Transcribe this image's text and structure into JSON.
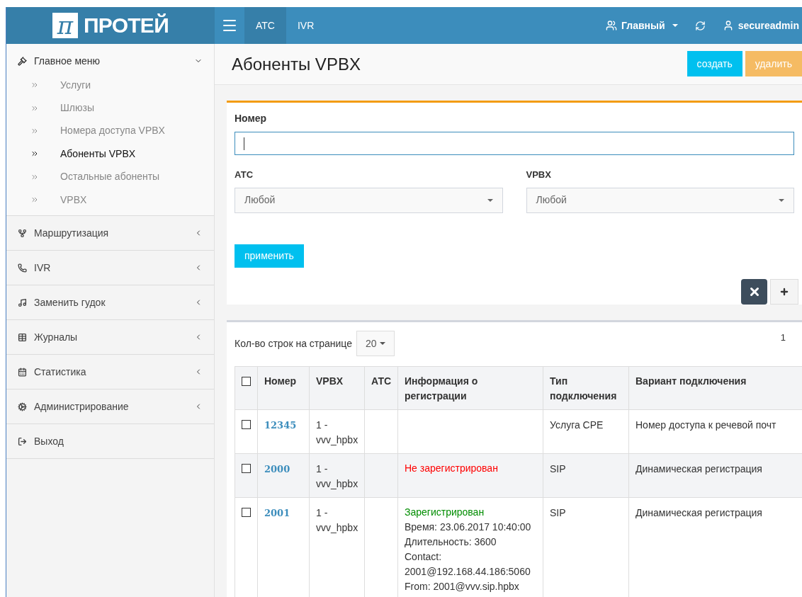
{
  "logo": {
    "mark": "π",
    "name": "ПРОТЕЙ"
  },
  "top_tabs": [
    {
      "label": "АТС",
      "selected": true
    },
    {
      "label": "IVR",
      "selected": false
    }
  ],
  "top_right": {
    "group": "Главный",
    "user": "secureadmin"
  },
  "sidebar": [
    {
      "label": "Главное меню",
      "kind": "group",
      "expanded": true,
      "children": [
        {
          "label": "Услуги",
          "selected": false
        },
        {
          "label": "Шлюзы",
          "selected": false
        },
        {
          "label": "Номера доступа VPBX",
          "selected": false
        },
        {
          "label": "Абоненты VPBX",
          "selected": true
        },
        {
          "label": "Остальные абоненты",
          "selected": false
        },
        {
          "label": "VPBX",
          "selected": false
        }
      ]
    },
    {
      "label": "Маршрутизация",
      "kind": "group",
      "expanded": false
    },
    {
      "label": "IVR",
      "kind": "group",
      "expanded": false
    },
    {
      "label": "Заменить гудок",
      "kind": "group",
      "expanded": false
    },
    {
      "label": "Журналы",
      "kind": "group",
      "expanded": false
    },
    {
      "label": "Статистика",
      "kind": "group",
      "expanded": false
    },
    {
      "label": "Администрирование",
      "kind": "group",
      "expanded": false
    },
    {
      "label": "Выход",
      "kind": "link"
    }
  ],
  "page_title": "Абоненты VPBX",
  "actions": [
    "создать",
    "удалить"
  ],
  "filter": {
    "number_label": "Номер",
    "atc_label": "АТС",
    "atc_value": "Любой",
    "vpbx_label": "VPBX",
    "vpbx_value": "Любой",
    "apply": "применить"
  },
  "table": {
    "select_all_checked": false,
    "page_size_label": "Кол-во строк на странице",
    "page_size": "20",
    "page": "1",
    "columns": [
      "Номер",
      "VPBX",
      "АТС",
      "Информация о регистрации",
      "Тип подключения",
      "Вариант подключения"
    ],
    "rows": [
      {
        "checked": false,
        "number": "12345",
        "vpbx": "1 - vvv_hpbx",
        "details": [],
        "type": "Услуга CPE",
        "variant": "Номер доступа к речевой почт"
      },
      {
        "checked": false,
        "number": "2000",
        "vpbx": "1 - vvv_hpbx",
        "status": {
          "text": "Не зарегистрирован",
          "kind": "unregistered"
        },
        "details": [],
        "type": "SIP",
        "variant": "Динамическая регистрация"
      },
      {
        "checked": false,
        "number": "2001",
        "vpbx": "1 - vvv_hpbx",
        "status": {
          "text": "Зарегистрирован",
          "kind": "registered"
        },
        "details": [
          "Время: 23.06.2017 10:40:00",
          "Длительность: 3600",
          "Contact: 2001@192.168.44.186:5060",
          "From: 2001@vvv.sip.hpbx"
        ],
        "type": "SIP",
        "variant": "Динамическая регистрация"
      }
    ]
  }
}
